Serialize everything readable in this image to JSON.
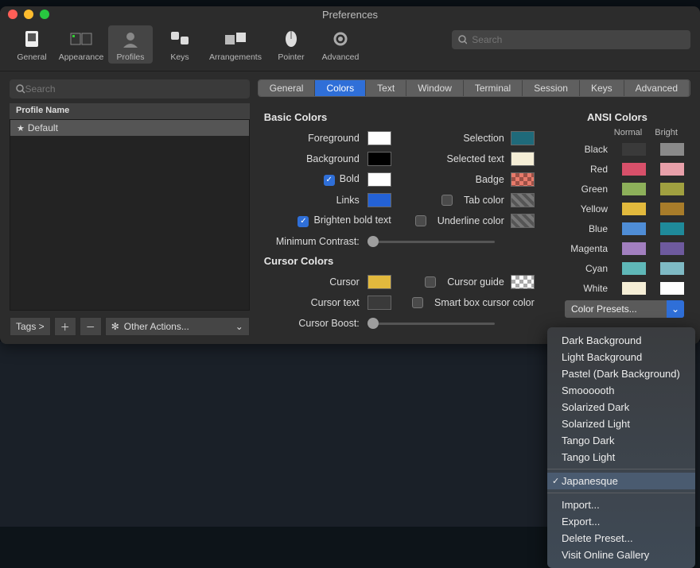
{
  "window": {
    "title": "Preferences"
  },
  "toolbar": {
    "items": [
      {
        "label": "General"
      },
      {
        "label": "Appearance"
      },
      {
        "label": "Profiles"
      },
      {
        "label": "Keys"
      },
      {
        "label": "Arrangements"
      },
      {
        "label": "Pointer"
      },
      {
        "label": "Advanced"
      }
    ],
    "active_index": 2,
    "search_placeholder": "Search"
  },
  "sidebar": {
    "search_placeholder": "Search",
    "header": "Profile Name",
    "profiles": [
      {
        "name": "Default",
        "starred": true
      }
    ],
    "footer": {
      "tags_label": "Tags >",
      "other_actions_label": "Other Actions..."
    }
  },
  "tabs": {
    "items": [
      "General",
      "Colors",
      "Text",
      "Window",
      "Terminal",
      "Session",
      "Keys",
      "Advanced"
    ],
    "active_index": 1
  },
  "colors": {
    "basic_header": "Basic Colors",
    "cursor_header": "Cursor Colors",
    "foreground": {
      "label": "Foreground",
      "value": "#ffffff"
    },
    "background": {
      "label": "Background",
      "value": "#000000"
    },
    "bold": {
      "label": "Bold",
      "value": "#ffffff",
      "checked": true
    },
    "links": {
      "label": "Links",
      "value": "#2462d6"
    },
    "brighten": {
      "label": "Brighten bold text",
      "checked": true
    },
    "min_contrast": {
      "label": "Minimum Contrast:"
    },
    "selection": {
      "label": "Selection",
      "value": "#1f6a7a"
    },
    "selected_text": {
      "label": "Selected text",
      "value": "#f5eed6"
    },
    "badge": {
      "label": "Badge",
      "value": "#e87a6a"
    },
    "tab_color": {
      "label": "Tab color",
      "checked": false
    },
    "underline_color": {
      "label": "Underline color",
      "checked": false
    },
    "cursor": {
      "label": "Cursor",
      "value": "#e2b93d"
    },
    "cursor_text": {
      "label": "Cursor text",
      "value": "#3a3a3a"
    },
    "cursor_guide": {
      "label": "Cursor guide",
      "checked": false
    },
    "smart_box": {
      "label": "Smart box cursor color",
      "checked": false
    },
    "cursor_boost": {
      "label": "Cursor Boost:"
    }
  },
  "ansi": {
    "header": "ANSI Colors",
    "normal_label": "Normal",
    "bright_label": "Bright",
    "rows": [
      {
        "name": "Black",
        "normal": "#3a3a3a",
        "bright": "#8a8a8a"
      },
      {
        "name": "Red",
        "normal": "#d8506a",
        "bright": "#e8a0aa"
      },
      {
        "name": "Green",
        "normal": "#8db05a",
        "bright": "#a0a040"
      },
      {
        "name": "Yellow",
        "normal": "#e2b93d",
        "bright": "#a87c2a"
      },
      {
        "name": "Blue",
        "normal": "#4f8dd6",
        "bright": "#1f8a9a"
      },
      {
        "name": "Magenta",
        "normal": "#a27fbf",
        "bright": "#6e5a9e"
      },
      {
        "name": "Cyan",
        "normal": "#5fb8b8",
        "bright": "#7fbac4"
      },
      {
        "name": "White",
        "normal": "#f5eed6",
        "bright": "#ffffff"
      }
    ]
  },
  "preset": {
    "button_label": "Color Presets...",
    "menu": [
      "Dark Background",
      "Light Background",
      "Pastel (Dark Background)",
      "Smoooooth",
      "Solarized Dark",
      "Solarized Light",
      "Tango Dark",
      "Tango Light"
    ],
    "selected": "Japanesque",
    "footer": [
      "Import...",
      "Export...",
      "Delete Preset...",
      "Visit Online Gallery"
    ]
  }
}
